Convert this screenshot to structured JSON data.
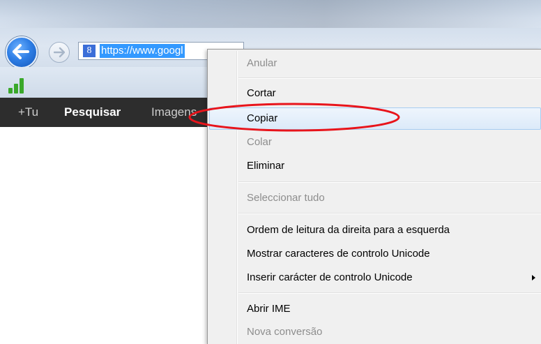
{
  "browser": {
    "address_bar": {
      "url": "https://www.googl",
      "search_icon_letter": "8"
    }
  },
  "google_bar": {
    "items": [
      {
        "label": "+Tu"
      },
      {
        "label": "Pesquisar"
      },
      {
        "label": "Imagens"
      }
    ]
  },
  "context_menu": {
    "items": [
      {
        "label": "Anular",
        "enabled": false
      },
      {
        "label": "Cortar",
        "enabled": true
      },
      {
        "label": "Copiar",
        "enabled": true,
        "hovered": true
      },
      {
        "label": "Colar",
        "enabled": false
      },
      {
        "label": "Eliminar",
        "enabled": true
      },
      {
        "label": "Seleccionar tudo",
        "enabled": false
      },
      {
        "label": "Ordem de leitura da direita para a esquerda",
        "enabled": true
      },
      {
        "label": "Mostrar caracteres de controlo Unicode",
        "enabled": true
      },
      {
        "label": "Inserir carácter de controlo Unicode",
        "enabled": true,
        "has_submenu": true
      },
      {
        "label": "Abrir IME",
        "enabled": true
      },
      {
        "label": "Nova conversão",
        "enabled": false
      }
    ]
  },
  "annotation": {
    "color": "#e8141b",
    "target": "Copiar"
  }
}
